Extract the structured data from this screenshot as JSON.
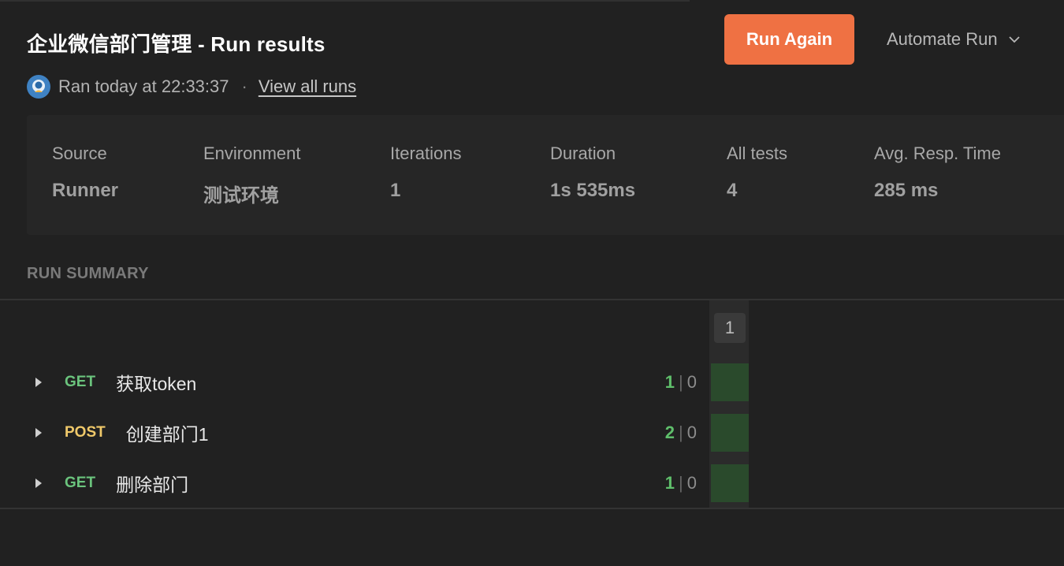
{
  "header": {
    "title": "企业微信部门管理 - Run results",
    "run_again_label": "Run Again",
    "automate_label": "Automate Run"
  },
  "meta": {
    "ran_text": "Ran today at 22:33:37",
    "separator": "·",
    "view_all_label": "View all runs"
  },
  "stats": [
    {
      "label": "Source",
      "value": "Runner"
    },
    {
      "label": "Environment",
      "value": "测试环境"
    },
    {
      "label": "Iterations",
      "value": "1"
    },
    {
      "label": "Duration",
      "value": "1s 535ms"
    },
    {
      "label": "All tests",
      "value": "4"
    },
    {
      "label": "Avg. Resp. Time",
      "value": "285 ms"
    }
  ],
  "summary": {
    "section_label": "RUN SUMMARY",
    "iteration_label": "1",
    "requests": [
      {
        "method": "GET",
        "name": "获取token",
        "passed": "1",
        "failed": "0"
      },
      {
        "method": "POST",
        "name": "创建部门1",
        "passed": "2",
        "failed": "0"
      },
      {
        "method": "GET",
        "name": "删除部门",
        "passed": "1",
        "failed": "0"
      }
    ]
  },
  "colors": {
    "accent": "#ef7143",
    "get": "#6bc47d",
    "post": "#f0c96a",
    "pass": "#5fbf6b",
    "iteration_cell": "#2a4a2c"
  },
  "icons": {
    "automate": "chevron-down-icon",
    "row": "caret-right-icon",
    "avatar": "user-avatar-icon"
  }
}
